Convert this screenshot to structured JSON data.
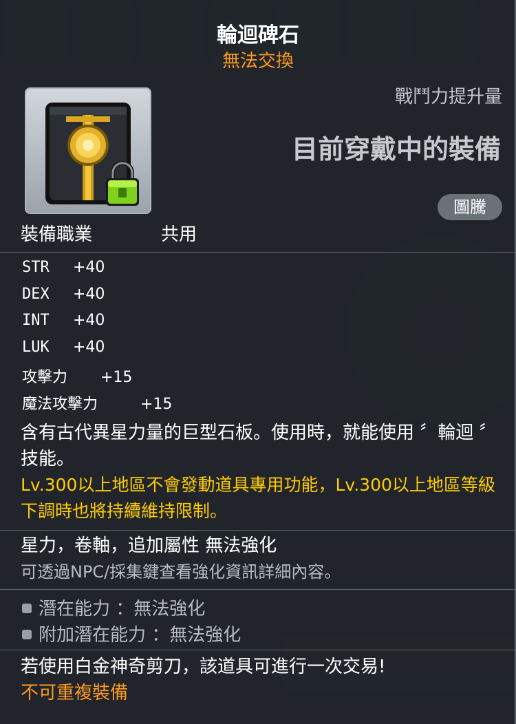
{
  "item": {
    "name": "輪迴碑石",
    "trade_status": "無法交換"
  },
  "header": {
    "power_label": "戰鬥力提升量",
    "current_equip": "目前穿戴中的裝備",
    "badge": "圖騰"
  },
  "job": {
    "label": "裝備職業",
    "value": "共用"
  },
  "stats": [
    {
      "key": "STR",
      "value": "+40"
    },
    {
      "key": "DEX",
      "value": "+40"
    },
    {
      "key": "INT",
      "value": "+40"
    },
    {
      "key": "LUK",
      "value": "+40"
    },
    {
      "key": "攻擊力",
      "value": "+15"
    },
    {
      "key": "魔法攻擊力",
      "value": "+15"
    }
  ],
  "description": {
    "main": "含有古代異星力量的巨型石板。使用時，就能使用 〞輪迴 〞技能。",
    "warning": "Lv.300以上地區不會發動道具專用功能，Lv.300以上地區等級下調時也將持續維持限制。"
  },
  "enhance": {
    "star_scroll": "星力，卷軸，追加屬性 無法強化",
    "npc_hint": "可透過NPC/採集鍵查看強化資訊詳細內容。"
  },
  "potential": [
    {
      "label": "潛在能力 ：無法強化"
    },
    {
      "label": "附加潛在能力 ：無法強化"
    }
  ],
  "footer": {
    "scissors": "若使用白金神奇剪刀，該道具可進行一次交易!",
    "unique": "不可重複裝備"
  },
  "colors": {
    "title": "#ffffff",
    "accent_orange": "#ff9a1f",
    "warning_yellow": "#ffcc00",
    "muted_gray": "#b7bcc1"
  }
}
